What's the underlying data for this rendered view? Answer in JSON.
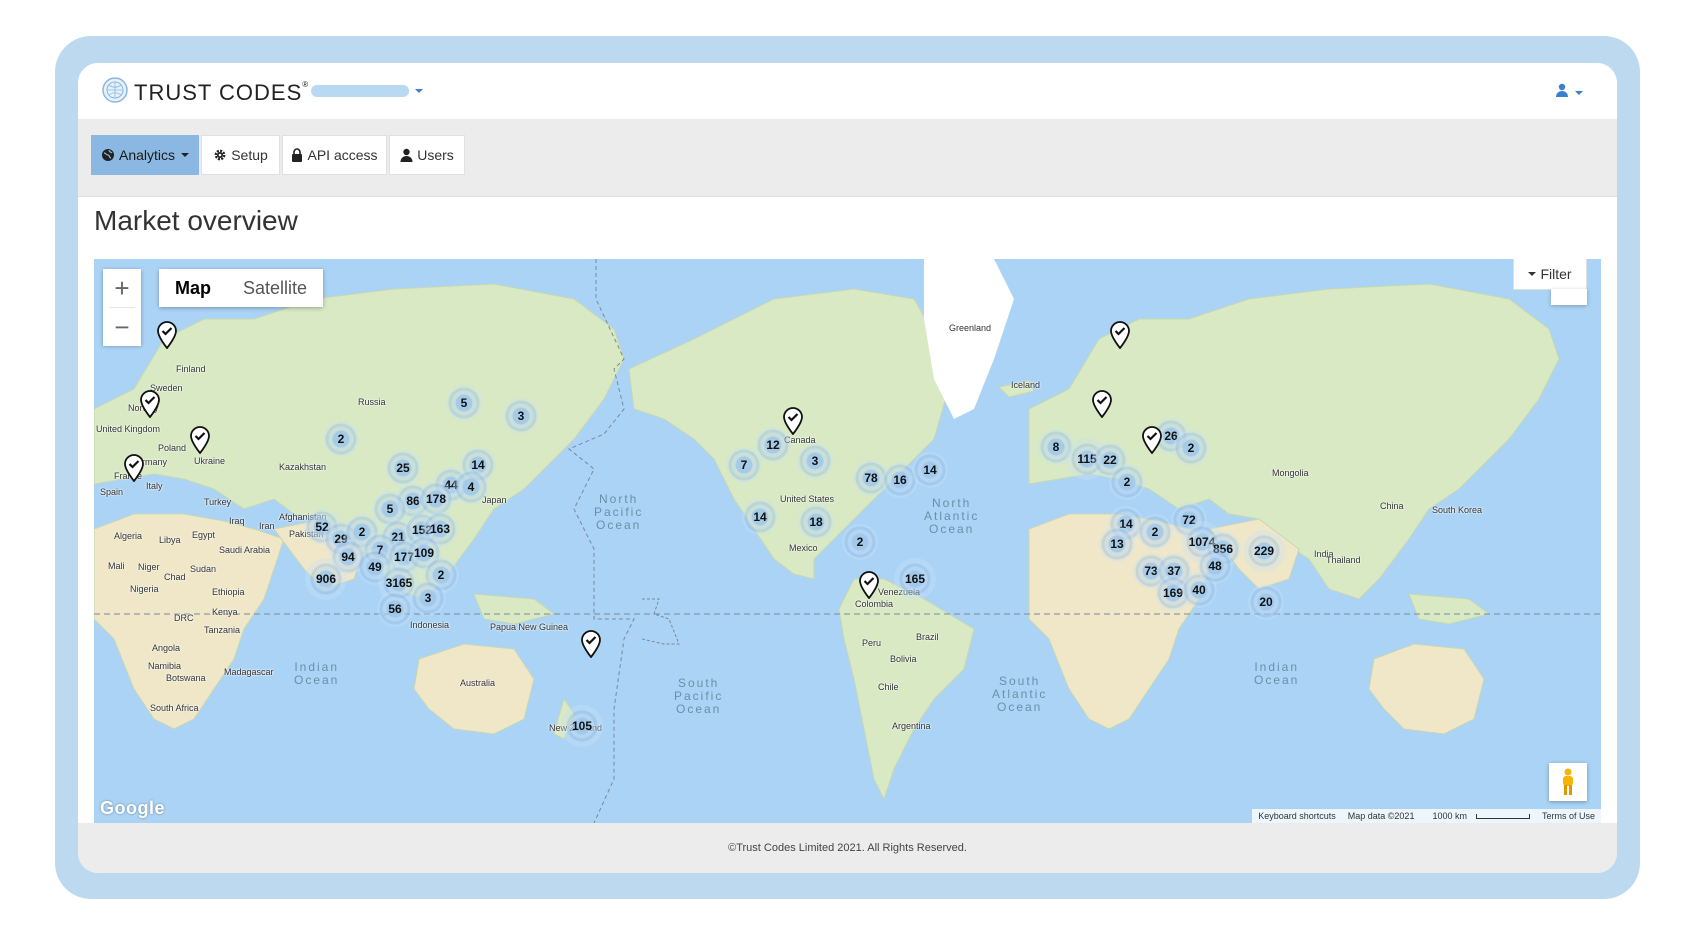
{
  "brand": {
    "name": "TRUST CODES",
    "mark": "®",
    "logo_icon": "globe-seal-icon"
  },
  "header": {
    "user_icon": "user-icon"
  },
  "tabs": [
    {
      "label": "Analytics",
      "icon": "globe-icon",
      "active": true
    },
    {
      "label": "Setup",
      "icon": "gear-icon",
      "active": false
    },
    {
      "label": "API access",
      "icon": "lock-icon",
      "active": false
    },
    {
      "label": "Users",
      "icon": "user-icon",
      "active": false
    }
  ],
  "page": {
    "title": "Market overview"
  },
  "map": {
    "type_buttons": {
      "map": "Map",
      "satellite": "Satellite"
    },
    "selected_type": "Map",
    "zoom": {
      "in": "+",
      "out": "−"
    },
    "filter_label": "Filter",
    "google": "Google",
    "attribution": {
      "shortcuts": "Keyboard shortcuts",
      "data": "Map data ©2021",
      "scale": "1000 km",
      "terms": "Terms of Use"
    },
    "oceans": [
      "North\nPacific\nOcean",
      "North\nAtlantic\nOcean",
      "South\nPacific\nOcean",
      "South\nAtlantic\nOcean",
      "Indian\nOcean",
      "Indian\nOcean"
    ],
    "places": [
      "Finland",
      "Sweden",
      "Norway",
      "United Kingdom",
      "Poland",
      "Germany",
      "Ukraine",
      "France",
      "Italy",
      "Spain",
      "Russia",
      "Kazakhstan",
      "Mongolia",
      "Turkey",
      "Iraq",
      "Iran",
      "Afghanistan",
      "Pakistan",
      "India",
      "China",
      "South Korea",
      "Japan",
      "Algeria",
      "Libya",
      "Egypt",
      "Saudi Arabia",
      "Mali",
      "Niger",
      "Chad",
      "Sudan",
      "Nigeria",
      "Ethiopia",
      "DRC",
      "Kenya",
      "Tanzania",
      "Angola",
      "Namibia",
      "Botswana",
      "Madagascar",
      "South Africa",
      "Indonesia",
      "Papua New Guinea",
      "Australia",
      "New Zealand",
      "Greenland",
      "Iceland",
      "Canada",
      "United States",
      "Mexico",
      "Venezuela",
      "Colombia",
      "Brazil",
      "Peru",
      "Bolivia",
      "Chile",
      "Argentina",
      "Thailand"
    ],
    "clusters": [
      "5",
      "3",
      "2",
      "14",
      "25",
      "44",
      "4",
      "86",
      "178",
      "5",
      "52",
      "29",
      "2",
      "21",
      "152",
      "163",
      "7",
      "177",
      "109",
      "94",
      "49",
      "906",
      "3165",
      "2",
      "3",
      "56",
      "105",
      "12",
      "7",
      "3",
      "78",
      "16",
      "14",
      "14",
      "18",
      "2",
      "165",
      "26",
      "2",
      "8",
      "115",
      "22",
      "2",
      "14",
      "13",
      "72",
      "2",
      "1074",
      "856",
      "229",
      "73",
      "37",
      "169",
      "40",
      "48",
      "20"
    ],
    "pins": 10
  },
  "footer": {
    "copyright": "©Trust Codes Limited 2021. All Rights Reserved."
  }
}
